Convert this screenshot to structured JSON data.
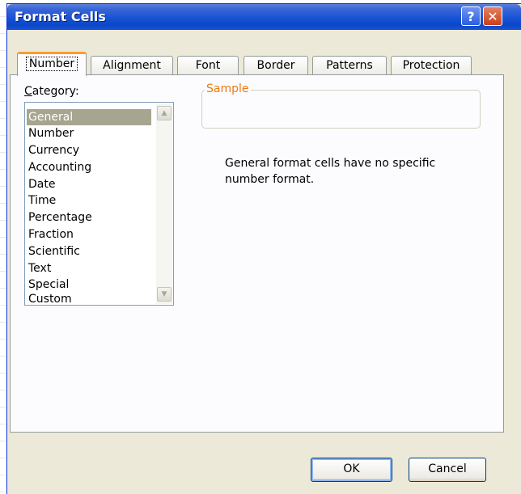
{
  "window": {
    "title": "Format Cells",
    "help_glyph": "?",
    "close_glyph": "✕"
  },
  "tabs": [
    {
      "label": "Number",
      "active": true
    },
    {
      "label": "Alignment"
    },
    {
      "label": "Font"
    },
    {
      "label": "Border"
    },
    {
      "label": "Patterns"
    },
    {
      "label": "Protection"
    }
  ],
  "category": {
    "label_prefix": "C",
    "label_rest": "ategory:",
    "items": [
      "General",
      "Number",
      "Currency",
      "Accounting",
      "Date",
      "Time",
      "Percentage",
      "Fraction",
      "Scientific",
      "Text",
      "Special",
      "Custom"
    ],
    "selected": "General"
  },
  "sample": {
    "legend": "Sample"
  },
  "description": "General format cells have no specific number format.",
  "buttons": {
    "ok": "OK",
    "cancel": "Cancel"
  },
  "colors": {
    "title_bar": "#1b55d6",
    "active_tab_accent": "#ff9a2e",
    "sample_legend": "#ec7a0f",
    "selection": "#a6a58f"
  },
  "icons": {
    "help": "help-icon",
    "close": "close-icon",
    "scroll_up": "chevron-up-icon",
    "scroll_down": "chevron-down-icon"
  }
}
